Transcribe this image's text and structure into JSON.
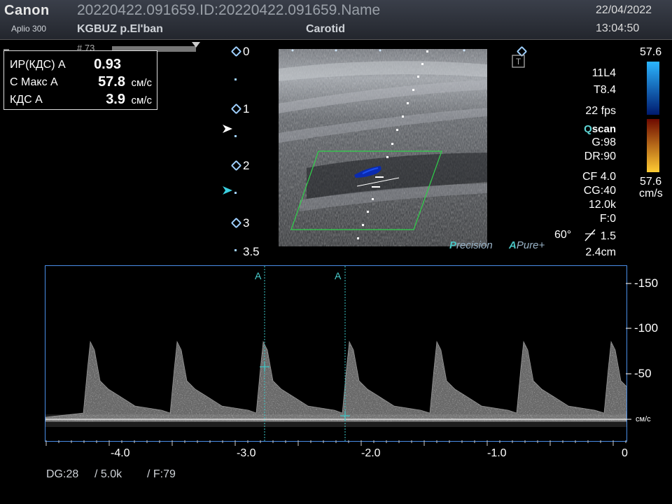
{
  "header": {
    "logo": "Canon",
    "model": "Aplio 300",
    "patient_id": "20220422.091659.ID:20220422.091659.Name",
    "hospital": "KGBUZ p.El'ban",
    "exam": "Carotid",
    "date": "22/04/2022",
    "time": "13:04:50"
  },
  "frame_label": "# 73",
  "measurements": [
    {
      "label": "ИР(КДС) А",
      "value": "0.93",
      "unit": ""
    },
    {
      "label": "С Макс А",
      "value": "57.8",
      "unit": "см/с"
    },
    {
      "label": "КДС А",
      "value": "3.9",
      "unit": "см/с"
    }
  ],
  "depth_scale": [
    "0",
    "1",
    "2",
    "3",
    "3.5"
  ],
  "params": {
    "probe": "11L4",
    "tis": "T8.4",
    "fps": "22 fps",
    "qscan_q": "Q",
    "qscan_rest": "scan",
    "gain": "G:98",
    "dr": "DR:90",
    "cf": "CF 4.0",
    "cg": "CG:40",
    "prf": "12.0k",
    "filter": "F:0",
    "angle": "60°",
    "angle_value": "1.5",
    "sample_depth": "2.4cm"
  },
  "color_bar": {
    "top_value": "57.6",
    "bottom_value": "57.6",
    "unit": "cm/s",
    "colors": {
      "pos_top": "#2bb5ff",
      "pos_bottom": "#001a6e",
      "neg_top": "#6e0a00",
      "neg_bottom": "#ffcc33"
    }
  },
  "branding": {
    "precision_p": "P",
    "precision_rest": "recision",
    "apure_a": "A",
    "apure_rest": "Pure+"
  },
  "spectral": {
    "y_ticks": [
      "-150",
      "-100",
      "-50",
      "см/с"
    ],
    "x_ticks": [
      "-4.0",
      "-3.0",
      "-2.0",
      "-1.0",
      "0"
    ],
    "cursor_label": "A",
    "footer": {
      "dg": "DG:28",
      "prf": "/ 5.0k",
      "filter": "/ F:79"
    }
  }
}
